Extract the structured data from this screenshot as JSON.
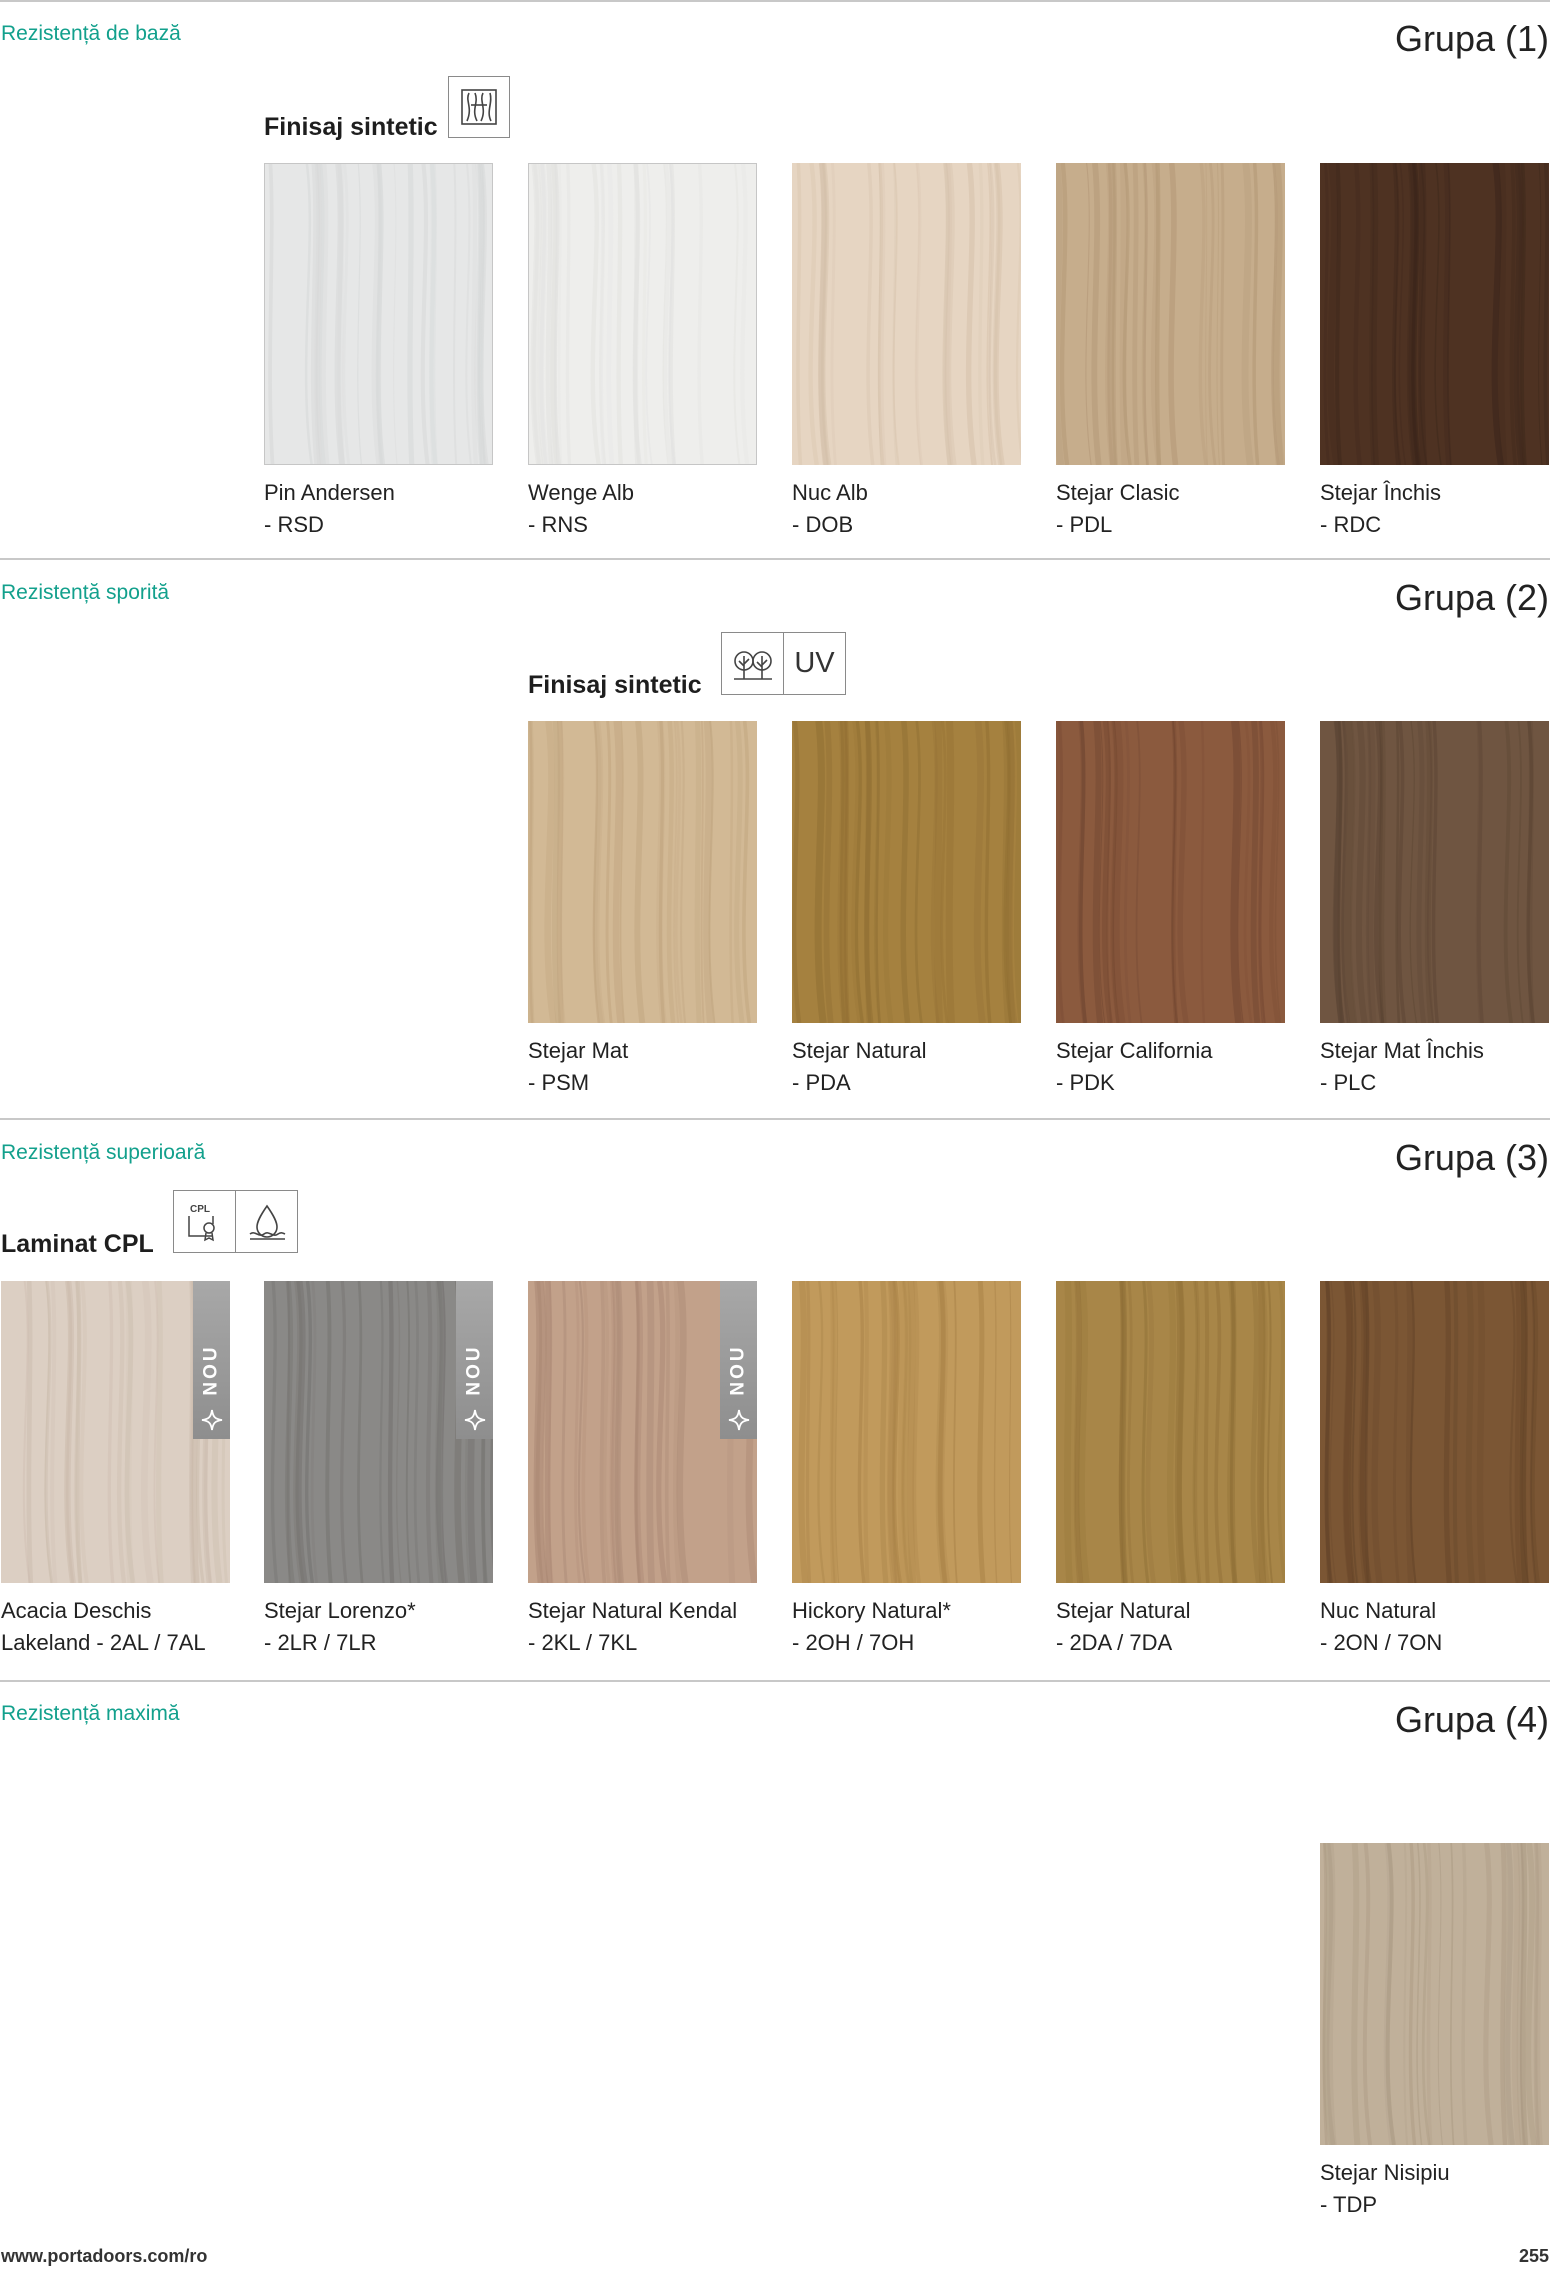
{
  "sections": [
    {
      "label": "Rezistență de bază",
      "group": "Grupa (1)",
      "finish": "Finisaj sintetic",
      "icons": [
        "wood-grain-icon"
      ],
      "swatches": [
        {
          "name": "Pin Andersen",
          "code": "- RSD",
          "color": "#e6e7e7",
          "dark": "#d4d6d6",
          "light": true
        },
        {
          "name": "Wenge Alb",
          "code": "- RNS",
          "color": "#eeeeec",
          "dark": "#e0e0de",
          "light": true
        },
        {
          "name": "Nuc Alb",
          "code": "- DOB",
          "color": "#e6d5c2",
          "dark": "#d3bfa8"
        },
        {
          "name": "Stejar Clasic",
          "code": "- PDL",
          "color": "#c6ad8c",
          "dark": "#ad9170"
        },
        {
          "name": "Stejar Închis",
          "code": "- RDC",
          "color": "#4e3222",
          "dark": "#38231a"
        }
      ]
    },
    {
      "label": "Rezistență sporită",
      "group": "Grupa (2)",
      "finish": "Finisaj sintetic",
      "icons": [
        "trees-icon"
      ],
      "icon_text": "UV",
      "swatches": [
        {
          "name": "Stejar Mat",
          "code": "- PSM",
          "color": "#d2b995",
          "dark": "#bda17c"
        },
        {
          "name": "Stejar Natural",
          "code": "- PDA",
          "color": "#a5813f",
          "dark": "#8b6a30"
        },
        {
          "name": "Stejar California",
          "code": "- PDK",
          "color": "#8b5a3e",
          "dark": "#6f4430"
        },
        {
          "name": "Stejar Mat Închis",
          "code": "- PLC",
          "color": "#6f5541",
          "dark": "#584231"
        }
      ]
    },
    {
      "label": "Rezistență superioară",
      "group": "Grupa (3)",
      "finish": "Laminat CPL",
      "icons": [
        "cpl-certificate-icon",
        "water-resistant-icon"
      ],
      "cpl_text": "CPL",
      "badge_text": "NOU",
      "swatches": [
        {
          "name": "Acacia Deschis",
          "code": "Lakeland - 2AL / 7AL",
          "color": "#dccfc3",
          "dark": "#c9b9aa",
          "new": true
        },
        {
          "name": "Stejar Lorenzo*",
          "code": "- 2LR / 7LR",
          "color": "#8a8987",
          "dark": "#6f6d6a",
          "new": true
        },
        {
          "name": "Stejar Natural Kendal",
          "code": "- 2KL / 7KL",
          "color": "#c2a18a",
          "dark": "#a88672",
          "new": true
        },
        {
          "name": "Hickory Natural*",
          "code": "- 2OH / 7OH",
          "color": "#c19a5c",
          "dark": "#a57f45"
        },
        {
          "name": "Stejar Natural",
          "code": "- 2DA / 7DA",
          "color": "#a88648",
          "dark": "#8c6c34"
        },
        {
          "name": "Nuc Natural",
          "code": "- 2ON / 7ON",
          "color": "#7b5634",
          "dark": "#5f4026"
        }
      ]
    },
    {
      "label": "Rezistență maximă",
      "group": "Grupa (4)",
      "swatches": [
        {
          "name": "Stejar Nisipiu",
          "code": "- TDP",
          "color": "#c0b09a",
          "dark": "#a89780"
        }
      ]
    }
  ],
  "footer": {
    "url": "www.portadoors.com/ro",
    "page": "255"
  }
}
